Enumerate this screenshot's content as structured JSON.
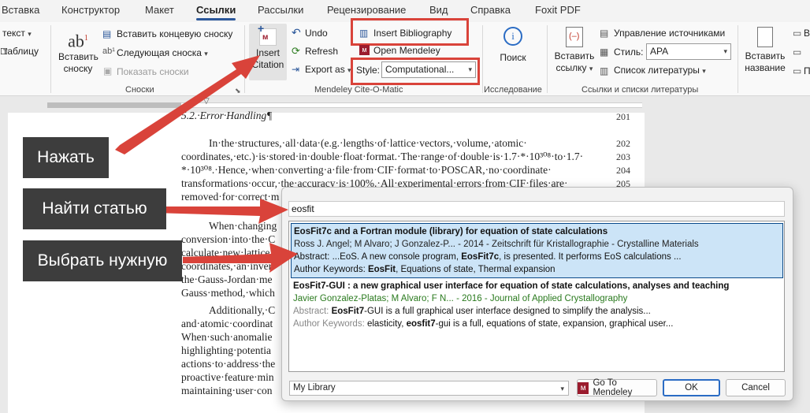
{
  "tabs": [
    "Вставка",
    "Конструктор",
    "Макет",
    "Ссылки",
    "Рассылки",
    "Рецензирование",
    "Вид",
    "Справка",
    "Foxit PDF"
  ],
  "ribbon": {
    "left_partial": {
      "text": "текст",
      "table": "таблицу"
    },
    "footnotes": {
      "insert_footnote": "Вставить сноску",
      "insert_endnote": "Вставить концевую сноску",
      "next_footnote": "Следующая сноска",
      "show_notes": "Показать сноски",
      "group_label": "Сноски"
    },
    "mendeley": {
      "insert_citation": "Insert Citation",
      "undo": "Undo",
      "refresh": "Refresh",
      "export_as": "Export as",
      "insert_bibliography": "Insert Bibliography",
      "open_mendeley": "Open Mendeley",
      "style_label": "Style:",
      "style_value": "Computational...",
      "group_label": "Mendeley Cite-O-Matic"
    },
    "research": {
      "search": "Поиск",
      "group_label": "Исследование"
    },
    "citations": {
      "insert_link": "Вставить ссылку",
      "manage_sources": "Управление источниками",
      "style_label": "Стиль:",
      "style_value": "APA",
      "bibliography": "Список литературы",
      "group_label": "Ссылки и списки литературы"
    },
    "captions": {
      "insert_caption": "Вставить название",
      "partial_a": "В",
      "partial_b": "П"
    }
  },
  "document": {
    "heading": "5.2.·Error·Handling¶",
    "lines": [
      "In·the·structures,·all·data·(e.g.·lengths·of·lattice·vectors,·volume,·atomic·",
      "coordinates,·etc.)·is·stored·in·double·float·format.·The·range·of·double·is·1.7·*·10³⁰⁸·to·1.7·",
      "*·10³⁰⁸.·Hence,·when·converting·a·file·from·CIF·format·to·POSCAR,·no·coordinate·",
      "transformations·occur,·the·accuracy·is·100%.·All·experimental·errors·from·CIF·files·are·",
      "removed·for·correct·m",
      "When·changing",
      "conversion·into·the·C",
      "calculate·new·lattice",
      "coordinates,·an·inver",
      "the·Gauss-Jordan·me",
      "Gauss·method,·which",
      "Additionally,·C",
      "and·atomic·coordinat",
      "When·such·anomalie",
      "highlighting·potentia",
      "actions·to·address·the",
      "proactive·feature·min",
      "maintaining·user·con"
    ],
    "line_numbers": [
      "201",
      "202",
      "203",
      "204",
      "205"
    ]
  },
  "annotations": {
    "click": "Нажать",
    "find": "Найти статью",
    "choose": "Выбрать нужную"
  },
  "dialog": {
    "search_value": "eosfit",
    "results": [
      {
        "title": "EosFit7c and a Fortran module (library) for equation of state calculations",
        "meta": "Ross J. Angel; M Alvaro; J Gonzalez-P... - 2014 - Zeitschrift für Kristallographie - Crystalline Materials",
        "abstract_key": "Abstract:",
        "abstract_pre": " ...EoS. A new console program, ",
        "abstract_bold": "EosFit7c",
        "abstract_post": ", is presented. It performs EoS calculations ...",
        "keywords_key": "Author Keywords:",
        "keywords_bold": "EosFit",
        "keywords_post": ", Equations of state, Thermal expansion"
      },
      {
        "title": "EosFit7-GUI : a new graphical user interface for equation of state calculations, analyses and teaching",
        "meta": "Javier Gonzalez-Platas; M Alvaro; F N... - 2016 - Journal of Applied Crystallography",
        "abstract_key": "Abstract:",
        "abstract_bold": "EosFit7",
        "abstract_post": "-GUI is a full graphical user interface designed to simplify the analysis...",
        "keywords_key": "Author Keywords:",
        "keywords_pre": " elasticity, ",
        "keywords_bold": "eosfit7",
        "keywords_post": "-gui is a full, equations of state, expansion, graphical user..."
      }
    ],
    "library": "My Library",
    "go_to_mendeley": "Go To Mendeley",
    "ok": "OK",
    "cancel": "Cancel"
  },
  "colors": {
    "accent": "#2b579a",
    "highlight": "#d9433a",
    "mendeley": "#9b1c2e",
    "selection": "#cce4f7"
  }
}
